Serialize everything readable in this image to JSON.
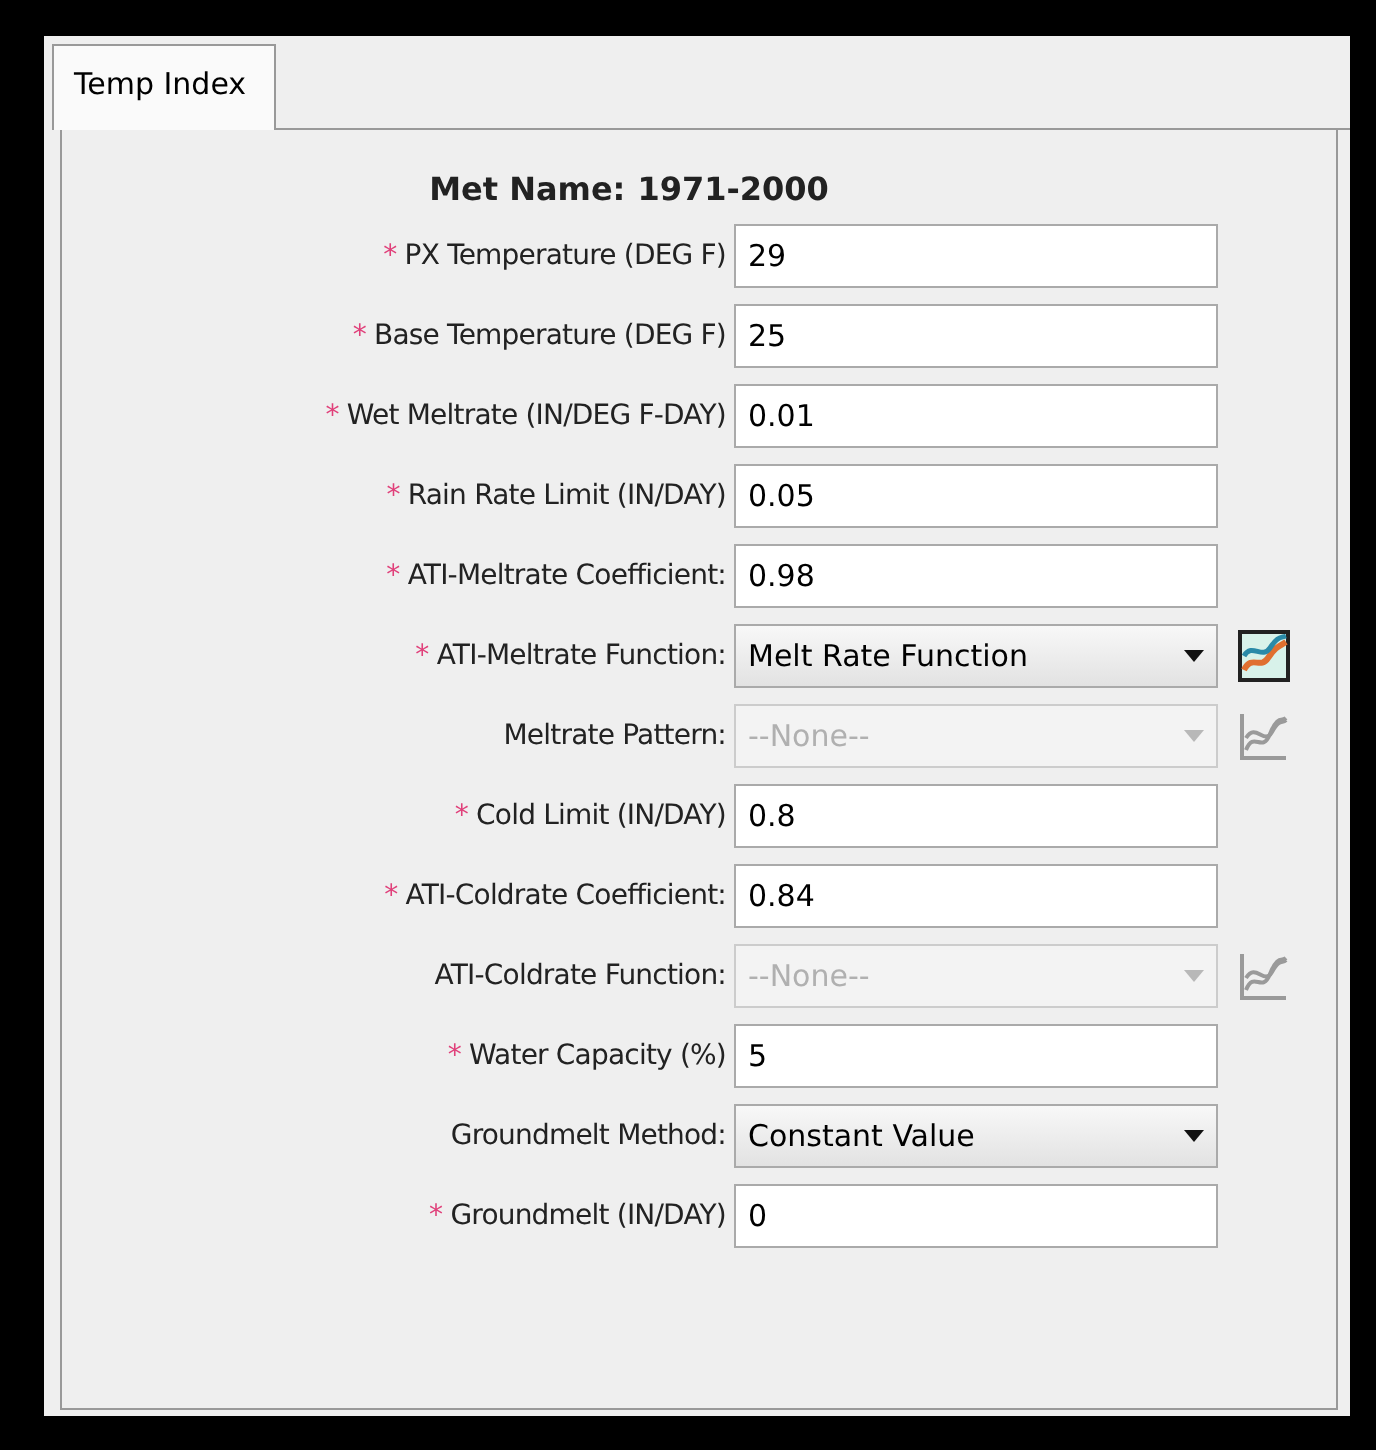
{
  "tabs": [
    {
      "label": "Temp Index",
      "selected": true
    }
  ],
  "required_marker": "*",
  "met_name": {
    "label": "Met Name:",
    "value": "1971-2000"
  },
  "fields": [
    {
      "kind": "text",
      "required": true,
      "label": "PX Temperature (DEG F)",
      "value": "29"
    },
    {
      "kind": "text",
      "required": true,
      "label": "Base Temperature (DEG F)",
      "value": "25"
    },
    {
      "kind": "text",
      "required": true,
      "label": "Wet Meltrate (IN/DEG F-DAY)",
      "value": "0.01"
    },
    {
      "kind": "text",
      "required": true,
      "label": "Rain Rate Limit (IN/DAY)",
      "value": "0.05"
    },
    {
      "kind": "text",
      "required": true,
      "label": "ATI-Meltrate Coefficient:",
      "value": "0.98"
    },
    {
      "kind": "select",
      "required": true,
      "label": "ATI-Meltrate Function:",
      "value": "Melt Rate Function",
      "disabled": false,
      "chart_button": {
        "disabled": false
      }
    },
    {
      "kind": "select",
      "required": false,
      "label": "Meltrate Pattern:",
      "value": "--None--",
      "disabled": true,
      "chart_button": {
        "disabled": true
      }
    },
    {
      "kind": "text",
      "required": true,
      "label": "Cold Limit (IN/DAY)",
      "value": "0.8"
    },
    {
      "kind": "text",
      "required": true,
      "label": "ATI-Coldrate Coefficient:",
      "value": "0.84"
    },
    {
      "kind": "select",
      "required": false,
      "label": "ATI-Coldrate Function:",
      "value": "--None--",
      "disabled": true,
      "chart_button": {
        "disabled": true
      }
    },
    {
      "kind": "text",
      "required": true,
      "label": "Water Capacity (%)",
      "value": "5"
    },
    {
      "kind": "select",
      "required": false,
      "label": "Groundmelt Method:",
      "value": "Constant Value",
      "disabled": false
    },
    {
      "kind": "text",
      "required": true,
      "label": "Groundmelt (IN/DAY)",
      "value": "0"
    }
  ]
}
